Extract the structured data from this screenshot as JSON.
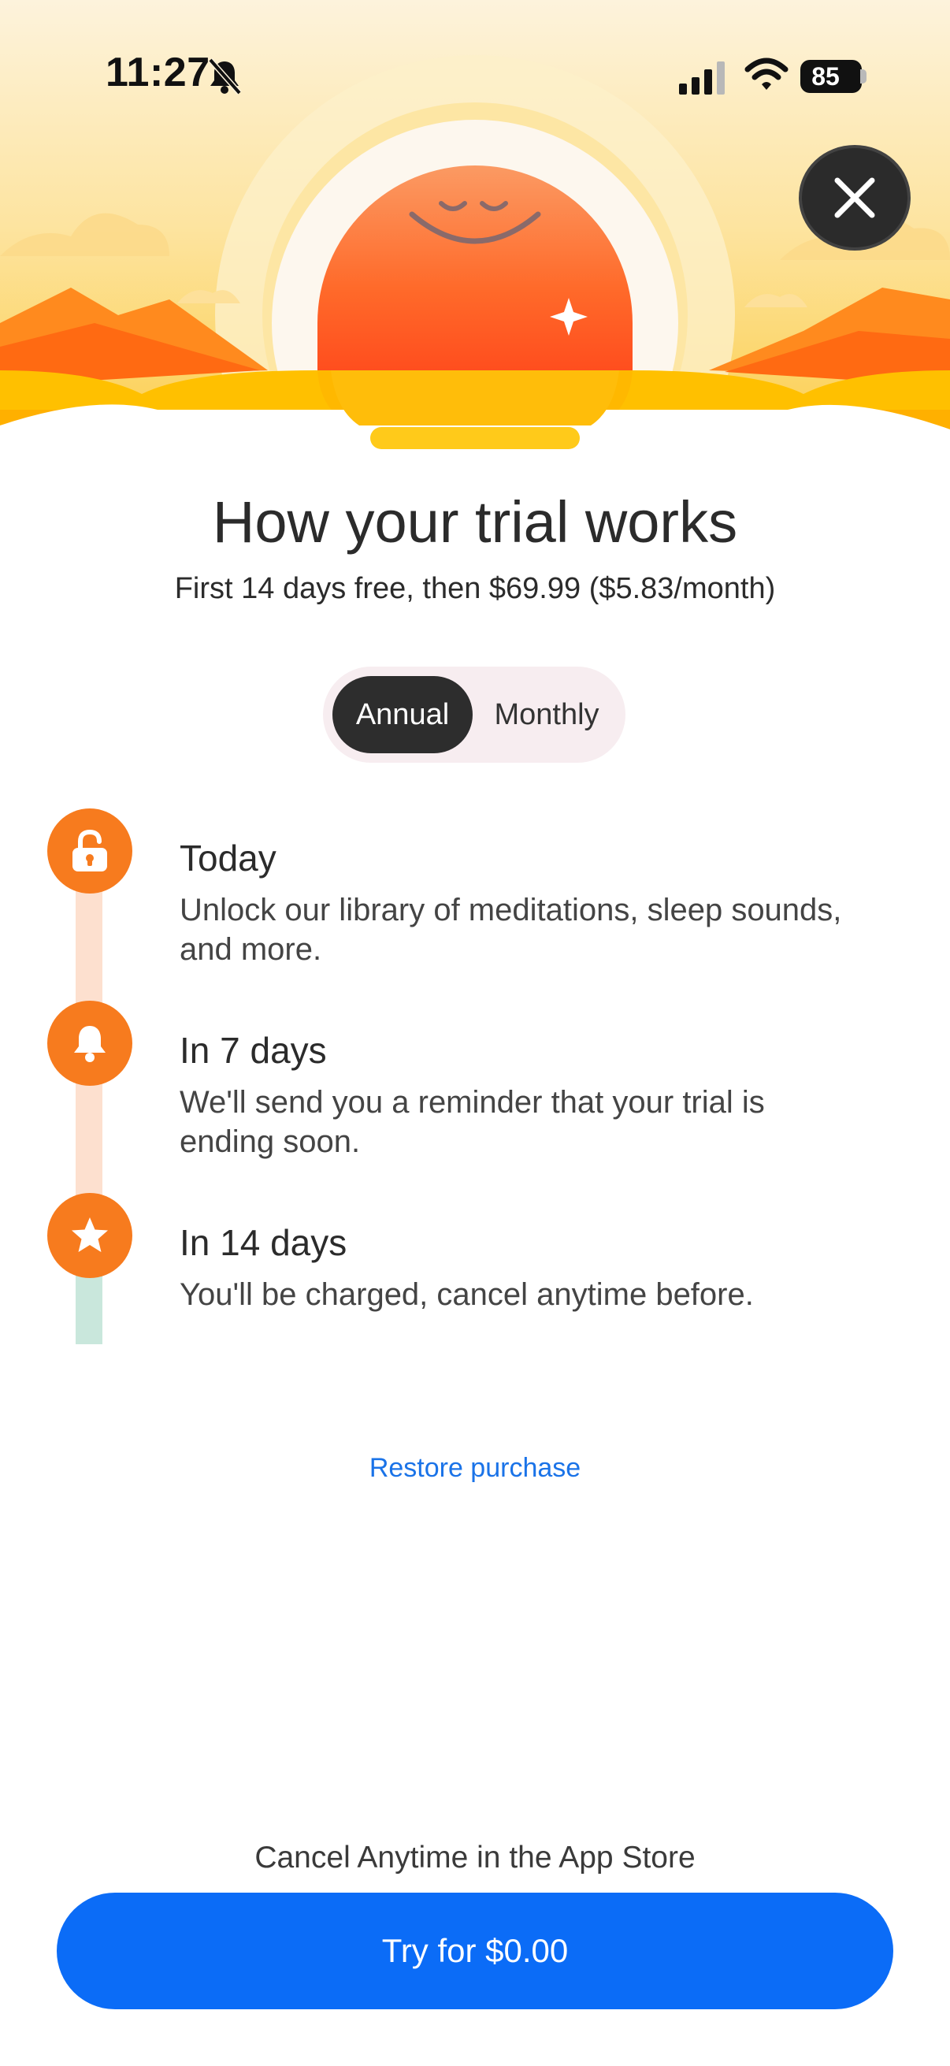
{
  "status_bar": {
    "time": "11:27",
    "battery": "85",
    "icons": [
      "bell-slash-icon",
      "cellular-signal-icon",
      "wifi-icon",
      "battery-icon"
    ]
  },
  "header": {
    "close_icon": "close-icon",
    "illustration": "smiling-sun-over-mountains"
  },
  "content": {
    "title": "How your trial works",
    "subtitle": "First 14 days free, then $69.99 ($5.83/month)"
  },
  "plan_toggle": {
    "options": [
      "Annual",
      "Monthly"
    ],
    "selected": "Annual"
  },
  "timeline": [
    {
      "icon": "unlock-icon",
      "title": "Today",
      "description": "Unlock our library of meditations, sleep sounds, and more."
    },
    {
      "icon": "bell-icon",
      "title": "In 7 days",
      "description": "We'll send you a reminder that your trial is ending soon."
    },
    {
      "icon": "star-icon",
      "title": "In 14 days",
      "description": "You'll be charged, cancel anytime before."
    }
  ],
  "links": {
    "restore": "Restore purchase"
  },
  "footer": {
    "note": "Cancel Anytime in the App Store",
    "cta_label": "Try for $0.00"
  },
  "colors": {
    "accent_orange": "#f77b1e",
    "cta_blue": "#0b6cf7",
    "link_blue": "#1a73e8",
    "toggle_active": "#2d2d2d"
  }
}
